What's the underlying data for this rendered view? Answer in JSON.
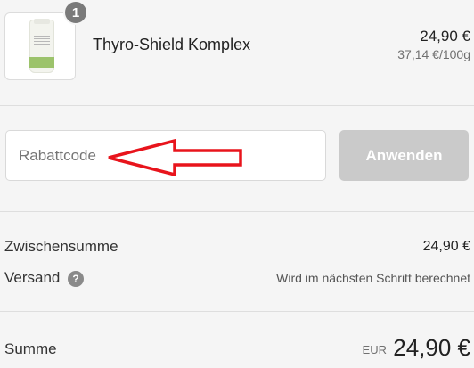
{
  "cart": {
    "item": {
      "name": "Thyro-Shield Komplex",
      "quantity": "1",
      "price": "24,90 €",
      "unit_price": "37,14 €/100g"
    }
  },
  "discount": {
    "placeholder": "Rabattcode",
    "apply_label": "Anwenden"
  },
  "summary": {
    "subtotal_label": "Zwischensumme",
    "subtotal_value": "24,90 €",
    "shipping_label": "Versand",
    "shipping_help": "?",
    "shipping_value": "Wird im nächsten Schritt berechnet",
    "total_label": "Summe",
    "total_currency": "EUR",
    "total_value": "24,90 €"
  },
  "colors": {
    "background": "#f5f5f5",
    "button_disabled": "#cacaca",
    "annotation_arrow": "#e8141c"
  }
}
